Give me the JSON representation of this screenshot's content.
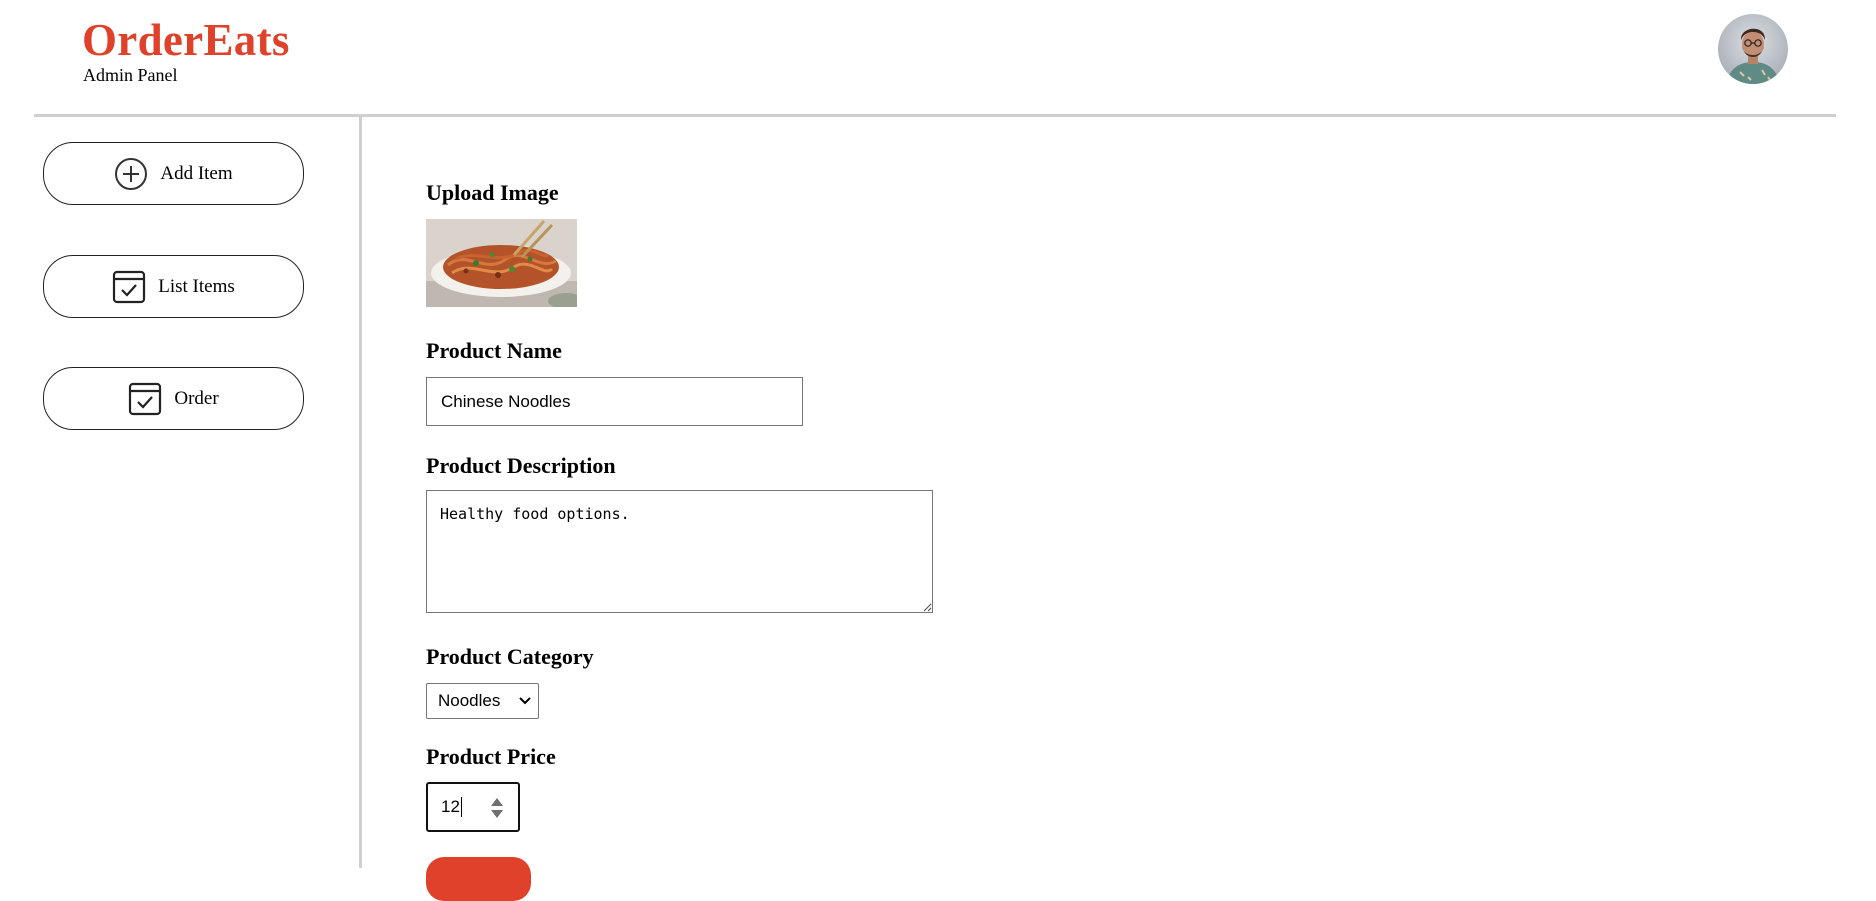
{
  "app": {
    "brand": "OrderEats",
    "subtitle": "Admin Panel",
    "accent_color": "#e0412a",
    "avatar_icon": "user-avatar-photo"
  },
  "sidebar": {
    "items": [
      {
        "label": "Add Item",
        "icon": "add-circle-icon"
      },
      {
        "label": "List Items",
        "icon": "checklist-icon"
      },
      {
        "label": "Order",
        "icon": "checklist-icon"
      }
    ]
  },
  "form": {
    "upload_label": "Upload Image",
    "upload_preview": "noodles-photo",
    "name_label": "Product Name",
    "name_value": "Chinese Noodles",
    "description_label": "Product Description",
    "description_value": "Healthy food options.",
    "category_label": "Product Category",
    "category_value": "Noodles",
    "price_label": "Product Price",
    "price_value": "12"
  }
}
